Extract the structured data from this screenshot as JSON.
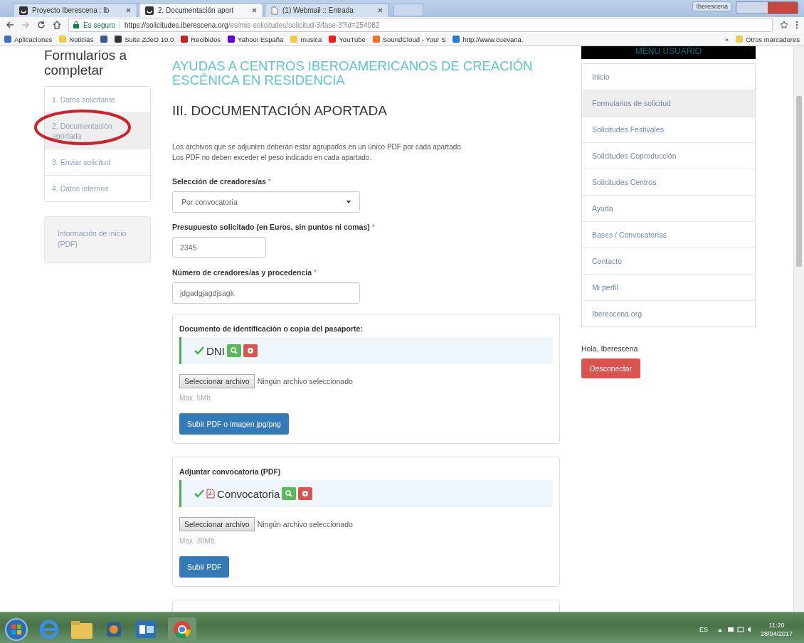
{
  "browser": {
    "tabs": [
      {
        "title": "Proyecto Iberescena : Ib",
        "kind": "site",
        "selected": false
      },
      {
        "title": "2. Documentación aport",
        "kind": "site",
        "selected": true
      },
      {
        "title": "(1) Webmail :: Entrada",
        "kind": "page",
        "selected": false
      }
    ],
    "profile": "Iberescena",
    "secure_label": "Es seguro",
    "url_host": "https://solicitudes.iberescena.org",
    "url_path": "/es/mis-solicitudes/solicitud-3/fase-3?id=254082",
    "bookmarks": [
      {
        "label": "Aplicaciones",
        "color": "#3a6fc4"
      },
      {
        "label": "Noticias",
        "color": "#f2c94c"
      },
      {
        "color": "#3b5998"
      },
      {
        "label": "Suite ZdeO 10.0",
        "color": "#333333"
      },
      {
        "label": "Recibidos",
        "color": "#c5221f"
      },
      {
        "label": "Yahoo! España",
        "color": "#5f01d1"
      },
      {
        "label": "musica",
        "color": "#f2c94c"
      },
      {
        "label": "YouTube",
        "color": "#e62117"
      },
      {
        "label": "SoundCloud - Your S",
        "color": "#f26f23"
      },
      {
        "label": "http://www.cuevana.",
        "color": "#2a7ad5"
      }
    ],
    "more": "»",
    "other_bookmarks": "Otros marcadores"
  },
  "left": {
    "title": "Formularios a completar",
    "steps": [
      {
        "label": "1. Datos solicitante",
        "selected": false,
        "circled": false
      },
      {
        "label": "2. Documentación aportada",
        "selected": true,
        "circled": true
      },
      {
        "label": "3. Enviar solicitud",
        "selected": false,
        "circled": false
      },
      {
        "label": "4. Datos internos",
        "selected": false,
        "circled": false
      }
    ],
    "info_link": "Información de inicio (PDF)"
  },
  "main": {
    "program_title": "AYUDAS A CENTROS IBEROAMERICANOS DE CREACIÓN ESCÉNICA EN RESIDENCIA",
    "section_title": "III. DOCUMENTACIÓN APORTADA",
    "intro": [
      "Los archivos que se adjunten deberán estar agrupados en un único PDF por cada apartado.",
      "Los PDF no deben exceder el peso indicado en cada apartado."
    ],
    "fields": [
      {
        "label": "Selección de creadores/as",
        "required": "*",
        "kind": "select",
        "value": "Por convocatoria"
      },
      {
        "label": "Presupuesto solicitado (en Euros, sin puntos ni comas)",
        "required": "*",
        "kind": "short",
        "value": "2345"
      },
      {
        "label": "Número de creadores/as y procedencia",
        "required": "*",
        "kind": "text",
        "value": "jdgadgjagdjsagk"
      }
    ],
    "uploads": [
      {
        "title": "Documento de identificación o copia del pasaporte:",
        "file": {
          "name": "DNI",
          "kind": "plain"
        },
        "choose": "Seleccionar archivo",
        "no_file": "Ningún archivo seleccionado",
        "max": "Max. 5Mb.",
        "submit": "Subir PDF o imagen jpg/png"
      },
      {
        "title": "Adjuntar convocatoria (PDF)",
        "file": {
          "name": "Convocatoria",
          "kind": "pdf"
        },
        "choose": "Seleccionar archivo",
        "no_file": "Ningún archivo seleccionado",
        "max": "Max. 30Mb.",
        "submit": "Subir PDF"
      }
    ]
  },
  "right": {
    "menu_title": "MENU USUARIO",
    "items": [
      {
        "label": "Inicio",
        "selected": false
      },
      {
        "label": "Formularios de solicitud",
        "selected": true
      },
      {
        "label": "Solicitudes Festivales",
        "selected": false
      },
      {
        "label": "Solicitudes Coproducción",
        "selected": false
      },
      {
        "label": "Solicitudes Centros",
        "selected": false
      },
      {
        "label": "Ayuda",
        "selected": false
      },
      {
        "label": "Bases / Convocatorias",
        "selected": false
      },
      {
        "label": "Contacto",
        "selected": false
      },
      {
        "label": "Mi perfil",
        "selected": false
      },
      {
        "label": "Iberescena.org",
        "selected": false
      }
    ],
    "greeting": "Hola, Iberescena",
    "logout": "Desconectar"
  },
  "taskbar": {
    "language": "ES",
    "time": "11:20",
    "date": "28/04/2017"
  }
}
